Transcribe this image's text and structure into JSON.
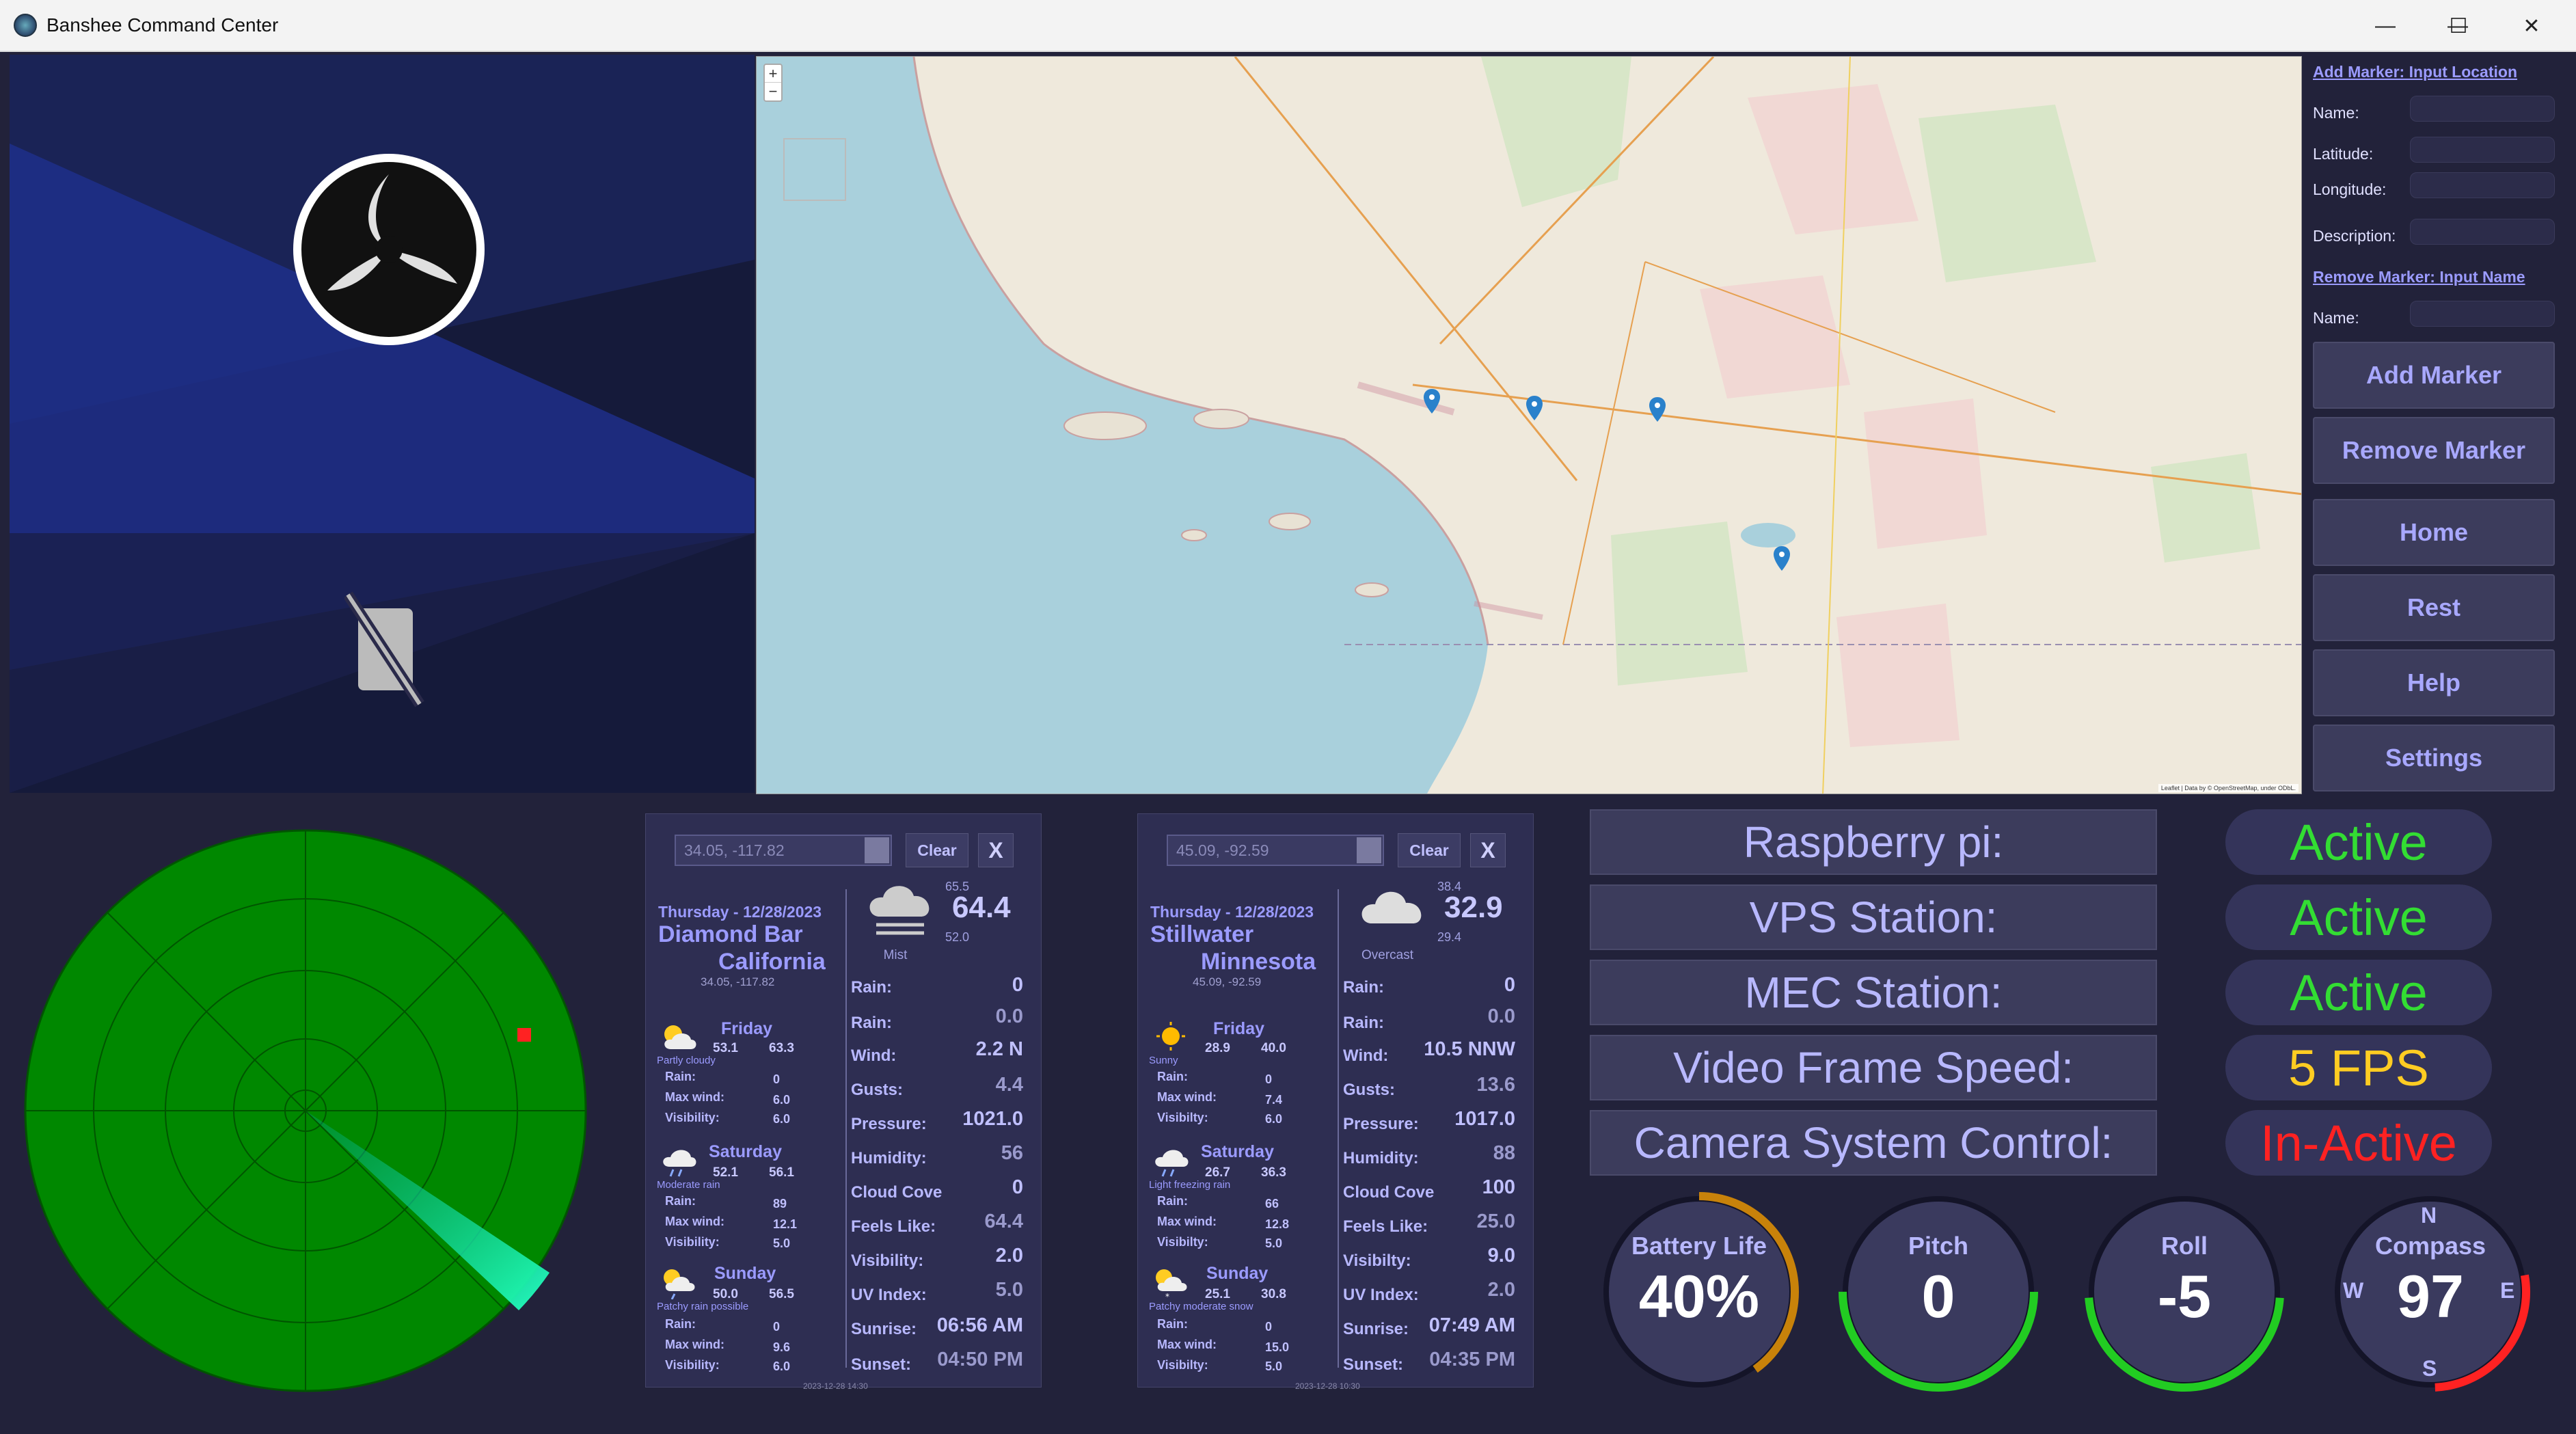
{
  "window": {
    "title": "Banshee Command Center",
    "minimize": "—",
    "maximize": "☐",
    "close": "✕"
  },
  "map": {
    "zoom_in": "+",
    "zoom_out": "−",
    "attribution": "Leaflet | Data by © OpenStreetMap, under ODbL."
  },
  "sidebar": {
    "add_marker_heading": "Add Marker: Input Location",
    "name_label": "Name:",
    "latitude_label": "Latitude:",
    "longitude_label": "Longitude:",
    "description_label": "Description:",
    "remove_marker_heading": "Remove Marker: Input Name",
    "remove_name_label": "Name:",
    "buttons": [
      "Add Marker",
      "Remove Marker",
      "Home",
      "Rest",
      "Help",
      "Settings"
    ]
  },
  "weather": [
    {
      "location_input": "34.05, -117.82",
      "clear_label": "Clear",
      "close_label": "X",
      "date": "Thursday - 12/28/2023",
      "city_line1": "Diamond Bar",
      "city_line2": "California",
      "coords": "34.05, -117.82",
      "high": "65.5",
      "temp": "64.4",
      "low": "52.0",
      "condition": "Mist",
      "stats": [
        {
          "label": "Rain:",
          "value": "0"
        },
        {
          "label": "Rain:",
          "value": "0.0"
        },
        {
          "label": "Wind:",
          "value": "2.2 N"
        },
        {
          "label": "Gusts:",
          "value": "4.4"
        },
        {
          "label": "Pressure:",
          "value": "1021.0"
        },
        {
          "label": "Humidity:",
          "value": "56"
        },
        {
          "label": "Cloud Cove",
          "value": "0"
        },
        {
          "label": "Feels Like:",
          "value": "64.4"
        },
        {
          "label": "Visibility:",
          "value": "2.0"
        },
        {
          "label": "UV Index:",
          "value": "5.0"
        },
        {
          "label": "Sunrise:",
          "value": "06:56 AM"
        },
        {
          "label": "Sunset:",
          "value": "04:50 PM"
        }
      ],
      "forecast": [
        {
          "day": "Friday",
          "high": "53.1",
          "low": "63.3",
          "condition": "Partly cloudy",
          "rain": "0",
          "max_wind": "6.0",
          "visibility": "6.0",
          "icon": "partly-cloudy"
        },
        {
          "day": "Saturday",
          "high": "52.1",
          "low": "56.1",
          "condition": "Moderate rain",
          "rain": "89",
          "max_wind": "12.1",
          "visibility": "5.0",
          "icon": "rain"
        },
        {
          "day": "Sunday",
          "high": "50.0",
          "low": "56.5",
          "condition": "Patchy rain possible",
          "rain": "0",
          "max_wind": "9.6",
          "visibility": "6.0",
          "icon": "sun-rain"
        }
      ],
      "fc_labels": {
        "rain": "Rain:",
        "max_wind": "Max wind:",
        "visibility": "Visibility:"
      },
      "footer": "2023-12-28 14:30"
    },
    {
      "location_input": "45.09, -92.59",
      "clear_label": "Clear",
      "close_label": "X",
      "date": "Thursday - 12/28/2023",
      "city_line1": "Stillwater",
      "city_line2": "Minnesota",
      "coords": "45.09, -92.59",
      "high": "38.4",
      "temp": "32.9",
      "low": "29.4",
      "condition": "Overcast",
      "stats": [
        {
          "label": "Rain:",
          "value": "0"
        },
        {
          "label": "Rain:",
          "value": "0.0"
        },
        {
          "label": "Wind:",
          "value": "10.5 NNW"
        },
        {
          "label": "Gusts:",
          "value": "13.6"
        },
        {
          "label": "Pressure:",
          "value": "1017.0"
        },
        {
          "label": "Humidity:",
          "value": "88"
        },
        {
          "label": "Cloud Cove",
          "value": "100"
        },
        {
          "label": "Feels Like:",
          "value": "25.0"
        },
        {
          "label": "Visibilty:",
          "value": "9.0"
        },
        {
          "label": "UV Index:",
          "value": "2.0"
        },
        {
          "label": "Sunrise:",
          "value": "07:49 AM"
        },
        {
          "label": "Sunset:",
          "value": "04:35 PM"
        }
      ],
      "forecast": [
        {
          "day": "Friday",
          "high": "28.9",
          "low": "40.0",
          "condition": "Sunny",
          "rain": "0",
          "max_wind": "7.4",
          "visibility": "6.0",
          "icon": "sun"
        },
        {
          "day": "Saturday",
          "high": "26.7",
          "low": "36.3",
          "condition": "Light freezing rain",
          "rain": "66",
          "max_wind": "12.8",
          "visibility": "5.0",
          "icon": "rain"
        },
        {
          "day": "Sunday",
          "high": "25.1",
          "low": "30.8",
          "condition": "Patchy moderate snow",
          "rain": "0",
          "max_wind": "15.0",
          "visibility": "5.0",
          "icon": "sun-snow"
        }
      ],
      "fc_labels": {
        "rain": "Rain:",
        "max_wind": "Max wind:",
        "visibility": "Visibilty:"
      },
      "footer": "2023-12-28 10:30"
    }
  ],
  "status": [
    {
      "label": "Raspberry pi:",
      "value": "Active",
      "color": "#33dd33"
    },
    {
      "label": "VPS Station:",
      "value": "Active",
      "color": "#33dd33"
    },
    {
      "label": "MEC Station:",
      "value": "Active",
      "color": "#33dd33"
    },
    {
      "label": "Video Frame Speed:",
      "value": "5 FPS",
      "color": "#ffcc22"
    },
    {
      "label": "Camera System Control:",
      "value": "In-Active",
      "color": "#ff2222"
    }
  ],
  "gauges": [
    {
      "title": "Battery Life",
      "value": "40%",
      "fraction": 0.4,
      "color": "#c8820a"
    },
    {
      "title": "Pitch",
      "value": "0",
      "fraction": 0.5,
      "color": "#22cc22"
    },
    {
      "title": "Roll",
      "value": "-5",
      "fraction": 0.48,
      "color": "#22cc22"
    },
    {
      "title": "Compass",
      "value": "97",
      "fraction": 0.27,
      "color": "#ff2222",
      "n": "N",
      "e": "E",
      "s": "S",
      "w": "W"
    }
  ],
  "radar": {
    "sweep_angle_deg": 130,
    "target_color": "#ff2222"
  },
  "colors": {
    "accent": "#9b9bff",
    "radar_green": "#008800",
    "active": "#33dd33",
    "warning": "#ffcc22",
    "alert": "#ff2222"
  }
}
